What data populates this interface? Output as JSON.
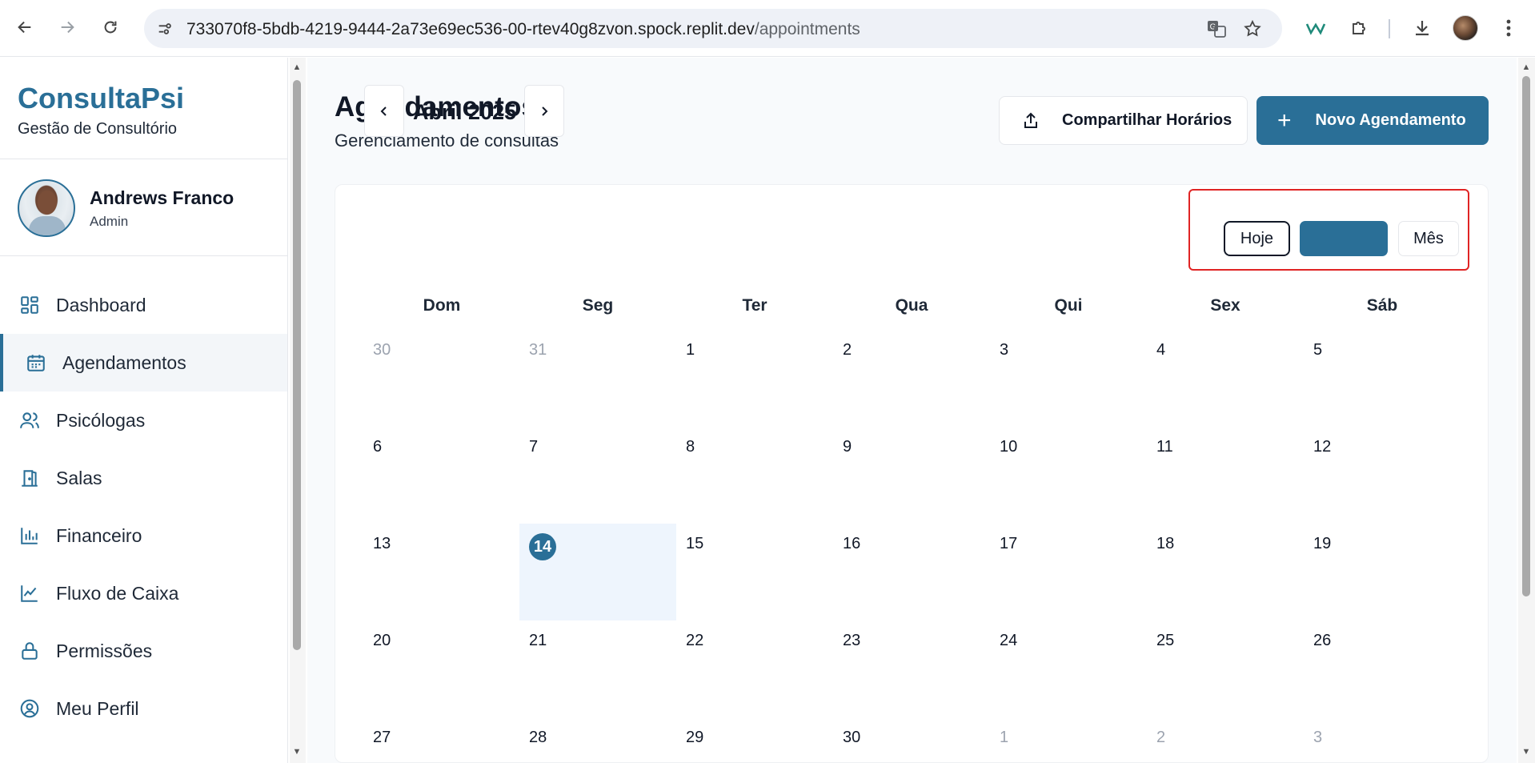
{
  "browser": {
    "url_host": "733070f8-5bdb-4219-9444-2a73e69ec536-00-rtev40g8zvon.spock.replit.dev",
    "url_path": "/appointments"
  },
  "sidebar": {
    "brand_title": "ConsultaPsi",
    "brand_subtitle": "Gestão de Consultório",
    "user_name": "Andrews Franco",
    "user_role": "Admin",
    "items": [
      {
        "label": "Dashboard",
        "icon": "dashboard-icon"
      },
      {
        "label": "Agendamentos",
        "icon": "calendar-icon",
        "active": true
      },
      {
        "label": "Psicólogas",
        "icon": "users-icon"
      },
      {
        "label": "Salas",
        "icon": "door-icon"
      },
      {
        "label": "Financeiro",
        "icon": "bar-chart-icon"
      },
      {
        "label": "Fluxo de Caixa",
        "icon": "line-chart-icon"
      },
      {
        "label": "Permissões",
        "icon": "lock-icon"
      },
      {
        "label": "Meu Perfil",
        "icon": "user-circle-icon"
      }
    ]
  },
  "header": {
    "title": "Agendamentos",
    "subtitle": "Gerenciamento de consultas",
    "share_button": "Compartilhar Horários",
    "new_button": "Novo Agendamento"
  },
  "calendar": {
    "month_label": "Abril 2025",
    "today_button": "Hoje",
    "week_button": "",
    "month_button": "Mês",
    "weekdays": [
      "Dom",
      "Seg",
      "Ter",
      "Qua",
      "Qui",
      "Sex",
      "Sáb"
    ],
    "weeks": [
      [
        {
          "d": "30",
          "o": true
        },
        {
          "d": "31",
          "o": true
        },
        {
          "d": "1"
        },
        {
          "d": "2"
        },
        {
          "d": "3"
        },
        {
          "d": "4"
        },
        {
          "d": "5"
        }
      ],
      [
        {
          "d": "6"
        },
        {
          "d": "7"
        },
        {
          "d": "8"
        },
        {
          "d": "9"
        },
        {
          "d": "10"
        },
        {
          "d": "11"
        },
        {
          "d": "12"
        }
      ],
      [
        {
          "d": "13"
        },
        {
          "d": "14",
          "t": true
        },
        {
          "d": "15"
        },
        {
          "d": "16"
        },
        {
          "d": "17"
        },
        {
          "d": "18"
        },
        {
          "d": "19"
        }
      ],
      [
        {
          "d": "20"
        },
        {
          "d": "21"
        },
        {
          "d": "22"
        },
        {
          "d": "23"
        },
        {
          "d": "24"
        },
        {
          "d": "25"
        },
        {
          "d": "26"
        }
      ],
      [
        {
          "d": "27"
        },
        {
          "d": "28"
        },
        {
          "d": "29"
        },
        {
          "d": "30"
        },
        {
          "d": "1",
          "o": true
        },
        {
          "d": "2",
          "o": true
        },
        {
          "d": "3",
          "o": true
        }
      ]
    ]
  },
  "colors": {
    "accent": "#2a6f97",
    "today_bg": "#eef5fd",
    "highlight_border": "#e02424"
  }
}
